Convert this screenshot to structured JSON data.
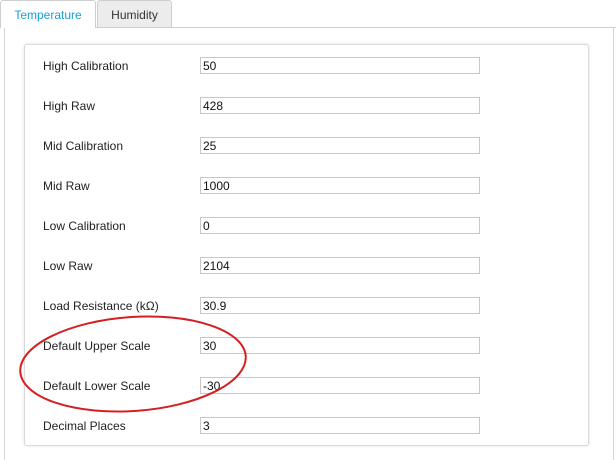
{
  "tabs": [
    {
      "label": "Temperature"
    },
    {
      "label": "Humidity"
    }
  ],
  "fields": [
    {
      "label": "High Calibration",
      "value": "50"
    },
    {
      "label": "High Raw",
      "value": "428"
    },
    {
      "label": "Mid Calibration",
      "value": "25"
    },
    {
      "label": "Mid Raw",
      "value": "1000"
    },
    {
      "label": "Low Calibration",
      "value": "0"
    },
    {
      "label": "Low Raw",
      "value": "2104"
    },
    {
      "label": "Load Resistance (kΩ)",
      "value": "30.9"
    },
    {
      "label": "Default Upper Scale",
      "value": "30"
    },
    {
      "label": "Default Lower Scale",
      "value": "-30"
    },
    {
      "label": "Decimal Places",
      "value": "3"
    }
  ],
  "colors": {
    "active_tab_text": "#1aa0d8",
    "annotation": "#d42020"
  }
}
